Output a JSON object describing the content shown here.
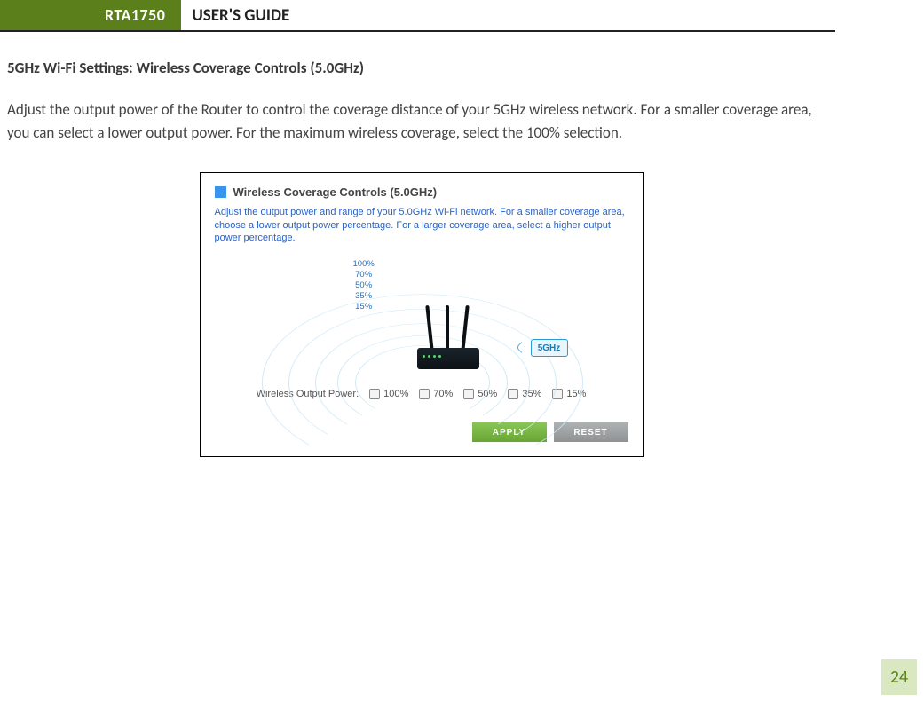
{
  "header": {
    "model": "RTA1750",
    "guide": "USER'S GUIDE"
  },
  "section": {
    "title": "5GHz Wi-Fi Settings: Wireless Coverage Controls (5.0GHz)",
    "body": "Adjust the output power of the Router to control the coverage distance of your 5GHz wireless network.  For a smaller coverage area, you can select a lower output power. For the maximum wireless coverage, select the 100% selection."
  },
  "panel": {
    "title": "Wireless Coverage Controls (5.0GHz)",
    "desc": "Adjust the output power and range of your 5.0GHz Wi-Fi network. For a smaller coverage area, choose a lower output power percentage. For a larger coverage area, select a higher output power percentage.",
    "percent_labels": [
      "100%",
      "70%",
      "50%",
      "35%",
      "15%"
    ],
    "badge": "5GHz",
    "options_label": "Wireless Output Power:",
    "options": [
      "100%",
      "70%",
      "50%",
      "35%",
      "15%"
    ],
    "apply": "APPLY",
    "reset": "RESET"
  },
  "page_number": "24"
}
